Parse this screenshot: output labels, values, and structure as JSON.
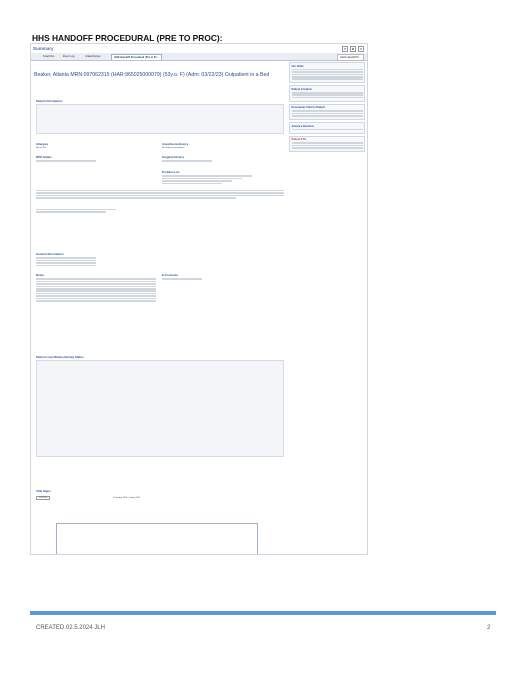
{
  "doc": {
    "title": "HHS HANDOFF PROCEDURAL (PRE TO PROC):",
    "footer_left": "CREATED 02.5.2024 JLH",
    "page_number": "2"
  },
  "screen": {
    "summary": "Summary",
    "tabs": [
      "SnapShot",
      "Event Log",
      "Intake/Output",
      "HHS Handoff Procedural (Pre to Pr..."
    ],
    "right_tab": "HHS Handoff Pr...",
    "patient_header": "Beaker, Atlanta MRN:097062315 (HAR:965025000079) (53y.o. F) (Adm: 03/22/23) Outpatient in a Bed",
    "sections": {
      "patient_info": "Patient Information",
      "allergies": "Allergies",
      "anesthesia": "Anesthesia History",
      "npo": "NPO Status",
      "surgical": "Surgical History",
      "problem_list": "Problem List",
      "general": "General Information",
      "notes": "Notes",
      "consents": "E-Consents",
      "lines": "Patient Lines/Drains/Airway Status",
      "vitals": "Vital Signs"
    },
    "allergies_value": "Not on File",
    "anesthesia_value": "No history of anesthesia",
    "vitals_date": "5/8/2024",
    "vitals_range": "Yesterday 2200 - Today 1959",
    "side": {
      "last_vitals": "Our Vitals",
      "patient_contacts": "Patient Contacts",
      "documents": "Documents Filed to Patient",
      "advance": "Advance Directive",
      "fyi": "Patient FYIs"
    }
  }
}
